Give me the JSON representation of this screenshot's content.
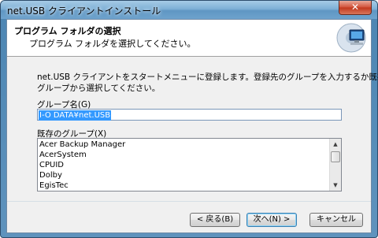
{
  "window": {
    "title": "net.USB クライアントインストール",
    "close_glyph": "✕"
  },
  "header": {
    "title": "プログラム フォルダの選択",
    "subtitle": "プログラム フォルダを選択してください。",
    "icon": "computer-install-icon"
  },
  "body": {
    "description_line1": "net.USB クライアントをスタートメニューに登録します。登録先のグループを入力するか既存の",
    "description_line2": "グループから選択してください。",
    "group_label": "グループ名(G)",
    "group_value": "I-O DATA¥net.USB",
    "existing_label": "既存のグループ(X)",
    "existing_groups": [
      "Acer Backup Manager",
      "AcerSystem",
      "CPUID",
      "Dolby",
      "EgisTec"
    ]
  },
  "buttons": {
    "back": "< 戻る(B)",
    "next": "次へ(N) >",
    "cancel": "キャンセル"
  }
}
